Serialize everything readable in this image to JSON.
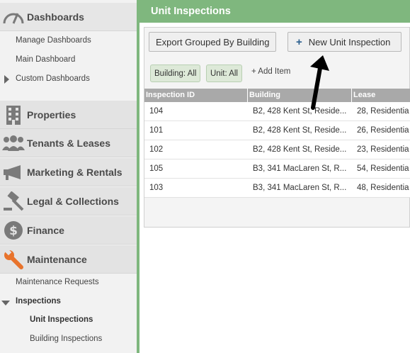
{
  "sidebar": {
    "dashboards": {
      "label": "Dashboards",
      "icon": "gauge-icon",
      "items": [
        "Manage Dashboards",
        "Main Dashboard",
        "Custom Dashboards"
      ]
    },
    "properties": {
      "label": "Properties",
      "icon": "building-icon"
    },
    "tenants": {
      "label": "Tenants & Leases",
      "icon": "people-icon"
    },
    "marketing": {
      "label": "Marketing & Rentals",
      "icon": "megaphone-icon"
    },
    "legal": {
      "label": "Legal & Collections",
      "icon": "gavel-icon"
    },
    "finance": {
      "label": "Finance",
      "icon": "dollar-icon"
    },
    "maintenance": {
      "label": "Maintenance",
      "icon": "wrench-icon",
      "items": [
        "Maintenance Requests",
        "Inspections"
      ],
      "inspections_items": [
        "Unit Inspections",
        "Building Inspections"
      ]
    }
  },
  "header": {
    "title": "Unit Inspections"
  },
  "toolbar": {
    "export_label": "Export Grouped By Building",
    "new_label": "New Unit Inspection"
  },
  "filters": {
    "building": "Building: All",
    "unit": "Unit: All",
    "add_item": "+ Add Item"
  },
  "table": {
    "headers": [
      "Inspection ID",
      "Building",
      "Lease"
    ],
    "rows": [
      {
        "id": "104",
        "building": "B2, 428 Kent St, Reside...",
        "lease": "28, Residentia"
      },
      {
        "id": "101",
        "building": "B2, 428 Kent St, Reside...",
        "lease": "26, Residentia"
      },
      {
        "id": "102",
        "building": "B2, 428 Kent St, Reside...",
        "lease": "23, Residentia"
      },
      {
        "id": "105",
        "building": "B3, 341 MacLaren St, R...",
        "lease": "54, Residentia"
      },
      {
        "id": "103",
        "building": "B3, 341 MacLaren St, R...",
        "lease": "48, Residentia"
      }
    ]
  },
  "colors": {
    "accent_green": "#7fb77e",
    "maintenance_orange": "#e8732c",
    "icon_gray": "#7a7a7a"
  }
}
